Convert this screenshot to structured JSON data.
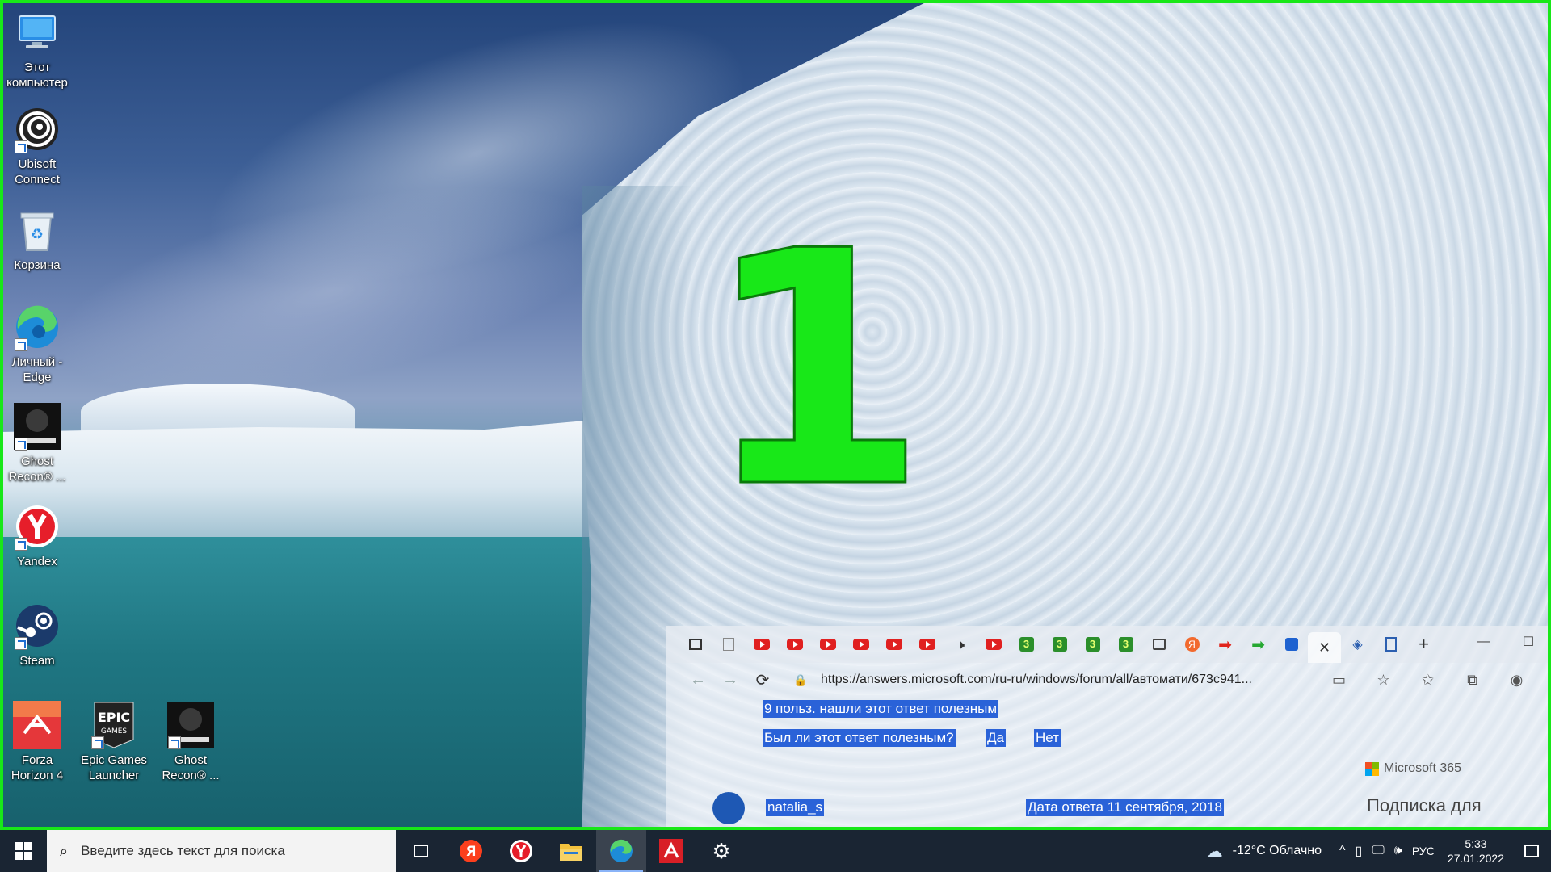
{
  "desktop": {
    "icons": [
      {
        "label": "Этот компьютер",
        "icon": "computer-icon"
      },
      {
        "label": "Ubisoft Connect",
        "icon": "ubisoft-icon"
      },
      {
        "label": "Корзина",
        "icon": "recycle-bin-icon"
      },
      {
        "label": "Личный - Edge",
        "icon": "edge-icon"
      },
      {
        "label": "Ghost Recon® ...",
        "icon": "ghost-recon-icon"
      },
      {
        "label": "Yandex",
        "icon": "yandex-browser-icon"
      },
      {
        "label": "Steam",
        "icon": "steam-icon"
      },
      {
        "label": "Forza Horizon 4",
        "icon": "forza-icon"
      },
      {
        "label": "Epic Games Launcher",
        "icon": "epic-games-icon"
      },
      {
        "label": "Ghost Recon® ...",
        "icon": "ghost-recon-icon"
      }
    ],
    "overlay_number": "1",
    "overlay_color": "#18e818"
  },
  "browser": {
    "url": "https://answers.microsoft.com/ru-ru/windows/forum/all/автомати/673c941...",
    "tabs": [
      "sidebar-icon",
      "page-icon",
      "youtube-icon",
      "youtube-icon",
      "youtube-icon",
      "youtube-icon",
      "youtube-icon",
      "youtube-icon",
      "speaker-icon",
      "youtube-icon",
      "g3-icon",
      "g3-icon",
      "g3-icon",
      "g3-icon",
      "calendar-icon",
      "yandex-icon",
      "red-arrow-icon",
      "green-arrow-icon",
      "blue-square-icon",
      "close-icon",
      "puzzle-icon",
      "share-icon"
    ],
    "content": {
      "helpful_count": "9 польз. нашли этот ответ полезным",
      "was_helpful": "Был ли этот ответ полезным?",
      "yes": "Да",
      "no": "Нет",
      "ms365": "Microsoft 365",
      "author": "natalia_s",
      "answer_date": "Дата ответа 11 сентября, 2018",
      "subscribe": "Подписка для"
    }
  },
  "taskbar": {
    "search_placeholder": "Введите здесь текст для поиска",
    "weather": "-12°C  Облачно",
    "language": "РУС",
    "time": "5:33",
    "date": "27.01.2022"
  }
}
